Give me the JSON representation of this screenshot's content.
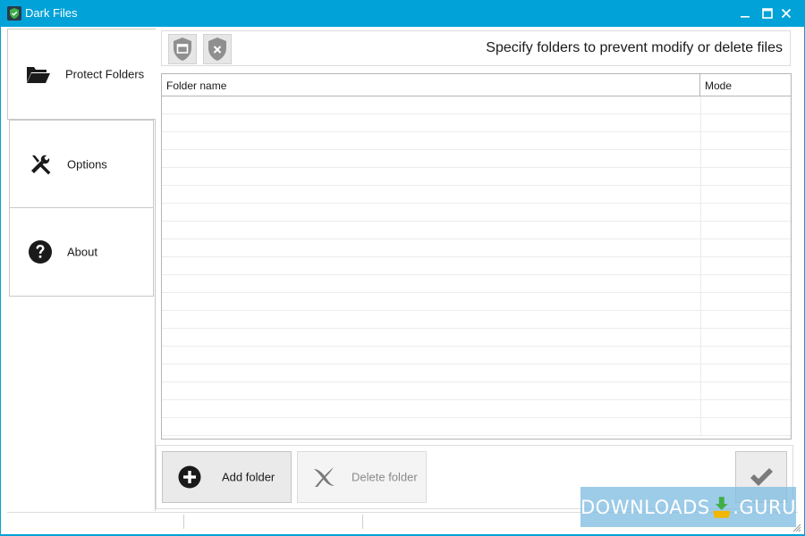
{
  "window": {
    "title": "Dark Files",
    "controls": [
      "minimize",
      "maximize",
      "close"
    ]
  },
  "sidebar": {
    "items": [
      {
        "label": "Protect Folders",
        "icon": "folder-open-icon",
        "active": true
      },
      {
        "label": "Options",
        "icon": "tools-icon",
        "active": false
      },
      {
        "label": "About",
        "icon": "question-icon",
        "active": false
      }
    ]
  },
  "toolbar": {
    "description": "Specify folders to prevent modify or delete files",
    "buttons": [
      {
        "icon": "shield-window-icon"
      },
      {
        "icon": "shield-x-icon"
      }
    ]
  },
  "table": {
    "columns": [
      "Folder name",
      "Mode"
    ],
    "rows": []
  },
  "actions": {
    "add_label": "Add folder",
    "delete_label": "Delete folder",
    "apply_icon": "checkmark-icon"
  },
  "watermark": {
    "left": "DOWNLOADS",
    "right": ".GURU"
  },
  "colors": {
    "titlebar": "#00a2d8",
    "watermark_bg": "#82bee1",
    "watermark_mark": "#f2b705",
    "watermark_arrow": "#3fae49"
  }
}
